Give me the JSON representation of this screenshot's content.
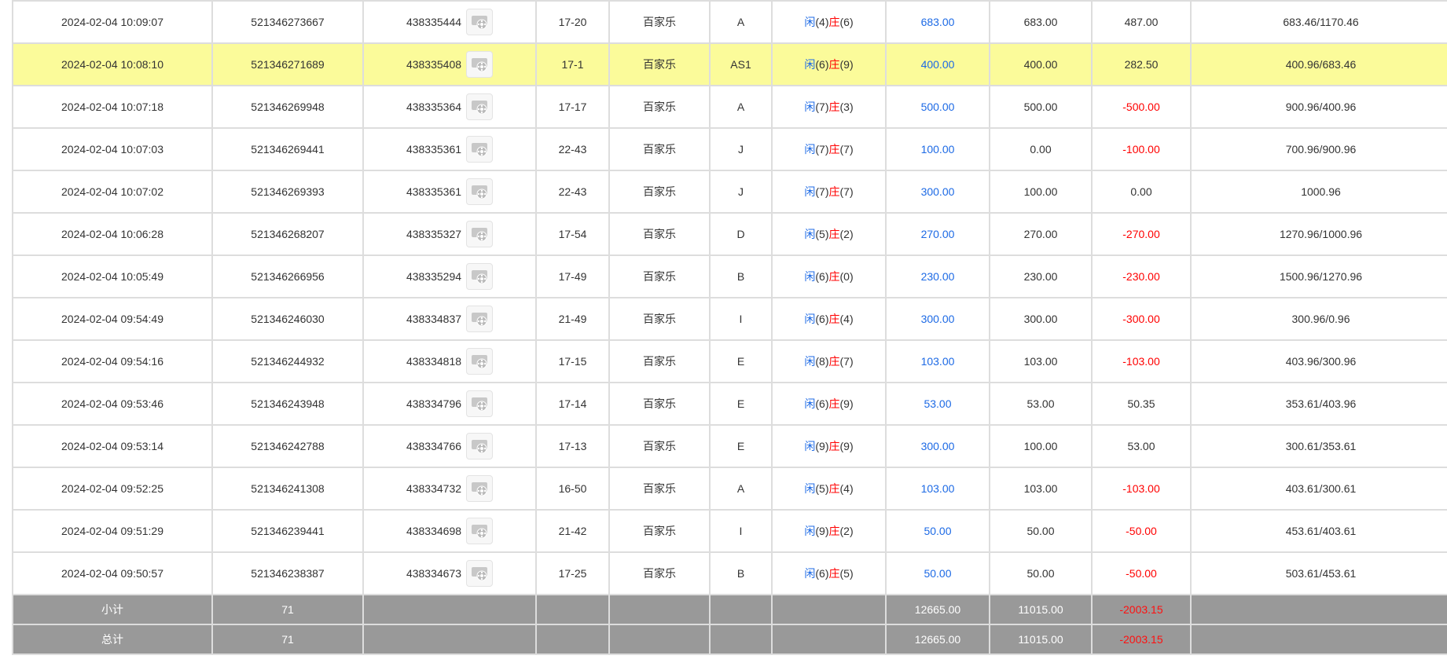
{
  "colors": {
    "blue": "#1d6ae5",
    "red": "#ff0000",
    "highlight": "#fbfb9a",
    "total_bg": "#999999"
  },
  "icons": {
    "replay": "video-replay-icon"
  },
  "rows": [
    {
      "time": "2024-02-04 10:09:07",
      "order": "521346273667",
      "table_id": "438335444",
      "shoe": "17-20",
      "game": "百家乐",
      "table": "A",
      "p_label": "闲",
      "p_val": "(4)",
      "b_label": "庄",
      "b_val": "(6)",
      "bet": "683.00",
      "valid": "683.00",
      "win": "487.00",
      "win_neg": false,
      "balance": "683.46/1170.46",
      "highlight": false
    },
    {
      "time": "2024-02-04 10:08:10",
      "order": "521346271689",
      "table_id": "438335408",
      "shoe": "17-1",
      "game": "百家乐",
      "table": "AS1",
      "p_label": "闲",
      "p_val": "(6)",
      "b_label": "庄",
      "b_val": "(9)",
      "bet": "400.00",
      "valid": "400.00",
      "win": "282.50",
      "win_neg": false,
      "balance": "400.96/683.46",
      "highlight": true
    },
    {
      "time": "2024-02-04 10:07:18",
      "order": "521346269948",
      "table_id": "438335364",
      "shoe": "17-17",
      "game": "百家乐",
      "table": "A",
      "p_label": "闲",
      "p_val": "(7)",
      "b_label": "庄",
      "b_val": "(3)",
      "bet": "500.00",
      "valid": "500.00",
      "win": "-500.00",
      "win_neg": true,
      "balance": "900.96/400.96",
      "highlight": false
    },
    {
      "time": "2024-02-04 10:07:03",
      "order": "521346269441",
      "table_id": "438335361",
      "shoe": "22-43",
      "game": "百家乐",
      "table": "J",
      "p_label": "闲",
      "p_val": "(7)",
      "b_label": "庄",
      "b_val": "(7)",
      "bet": "100.00",
      "valid": "0.00",
      "win": "-100.00",
      "win_neg": true,
      "balance": "700.96/900.96",
      "highlight": false
    },
    {
      "time": "2024-02-04 10:07:02",
      "order": "521346269393",
      "table_id": "438335361",
      "shoe": "22-43",
      "game": "百家乐",
      "table": "J",
      "p_label": "闲",
      "p_val": "(7)",
      "b_label": "庄",
      "b_val": "(7)",
      "bet": "300.00",
      "valid": "100.00",
      "win": "0.00",
      "win_neg": false,
      "balance": "1000.96",
      "highlight": false
    },
    {
      "time": "2024-02-04 10:06:28",
      "order": "521346268207",
      "table_id": "438335327",
      "shoe": "17-54",
      "game": "百家乐",
      "table": "D",
      "p_label": "闲",
      "p_val": "(5)",
      "b_label": "庄",
      "b_val": "(2)",
      "bet": "270.00",
      "valid": "270.00",
      "win": "-270.00",
      "win_neg": true,
      "balance": "1270.96/1000.96",
      "highlight": false
    },
    {
      "time": "2024-02-04 10:05:49",
      "order": "521346266956",
      "table_id": "438335294",
      "shoe": "17-49",
      "game": "百家乐",
      "table": "B",
      "p_label": "闲",
      "p_val": "(6)",
      "b_label": "庄",
      "b_val": "(0)",
      "bet": "230.00",
      "valid": "230.00",
      "win": "-230.00",
      "win_neg": true,
      "balance": "1500.96/1270.96",
      "highlight": false
    },
    {
      "time": "2024-02-04 09:54:49",
      "order": "521346246030",
      "table_id": "438334837",
      "shoe": "21-49",
      "game": "百家乐",
      "table": "I",
      "p_label": "闲",
      "p_val": "(6)",
      "b_label": "庄",
      "b_val": "(4)",
      "bet": "300.00",
      "valid": "300.00",
      "win": "-300.00",
      "win_neg": true,
      "balance": "300.96/0.96",
      "highlight": false
    },
    {
      "time": "2024-02-04 09:54:16",
      "order": "521346244932",
      "table_id": "438334818",
      "shoe": "17-15",
      "game": "百家乐",
      "table": "E",
      "p_label": "闲",
      "p_val": "(8)",
      "b_label": "庄",
      "b_val": "(7)",
      "bet": "103.00",
      "valid": "103.00",
      "win": "-103.00",
      "win_neg": true,
      "balance": "403.96/300.96",
      "highlight": false
    },
    {
      "time": "2024-02-04 09:53:46",
      "order": "521346243948",
      "table_id": "438334796",
      "shoe": "17-14",
      "game": "百家乐",
      "table": "E",
      "p_label": "闲",
      "p_val": "(6)",
      "b_label": "庄",
      "b_val": "(9)",
      "bet": "53.00",
      "valid": "53.00",
      "win": "50.35",
      "win_neg": false,
      "balance": "353.61/403.96",
      "highlight": false
    },
    {
      "time": "2024-02-04 09:53:14",
      "order": "521346242788",
      "table_id": "438334766",
      "shoe": "17-13",
      "game": "百家乐",
      "table": "E",
      "p_label": "闲",
      "p_val": "(9)",
      "b_label": "庄",
      "b_val": "(9)",
      "bet": "300.00",
      "valid": "100.00",
      "win": "53.00",
      "win_neg": false,
      "balance": "300.61/353.61",
      "highlight": false
    },
    {
      "time": "2024-02-04 09:52:25",
      "order": "521346241308",
      "table_id": "438334732",
      "shoe": "16-50",
      "game": "百家乐",
      "table": "A",
      "p_label": "闲",
      "p_val": "(5)",
      "b_label": "庄",
      "b_val": "(4)",
      "bet": "103.00",
      "valid": "103.00",
      "win": "-103.00",
      "win_neg": true,
      "balance": "403.61/300.61",
      "highlight": false
    },
    {
      "time": "2024-02-04 09:51:29",
      "order": "521346239441",
      "table_id": "438334698",
      "shoe": "21-42",
      "game": "百家乐",
      "table": "I",
      "p_label": "闲",
      "p_val": "(9)",
      "b_label": "庄",
      "b_val": "(2)",
      "bet": "50.00",
      "valid": "50.00",
      "win": "-50.00",
      "win_neg": true,
      "balance": "453.61/403.61",
      "highlight": false
    },
    {
      "time": "2024-02-04 09:50:57",
      "order": "521346238387",
      "table_id": "438334673",
      "shoe": "17-25",
      "game": "百家乐",
      "table": "B",
      "p_label": "闲",
      "p_val": "(6)",
      "b_label": "庄",
      "b_val": "(5)",
      "bet": "50.00",
      "valid": "50.00",
      "win": "-50.00",
      "win_neg": true,
      "balance": "503.61/453.61",
      "highlight": false
    }
  ],
  "subtotal": {
    "label": "小计",
    "count": "71",
    "bet": "12665.00",
    "valid": "11015.00",
    "win": "-2003.15"
  },
  "total": {
    "label": "总计",
    "count": "71",
    "bet": "12665.00",
    "valid": "11015.00",
    "win": "-2003.15"
  }
}
